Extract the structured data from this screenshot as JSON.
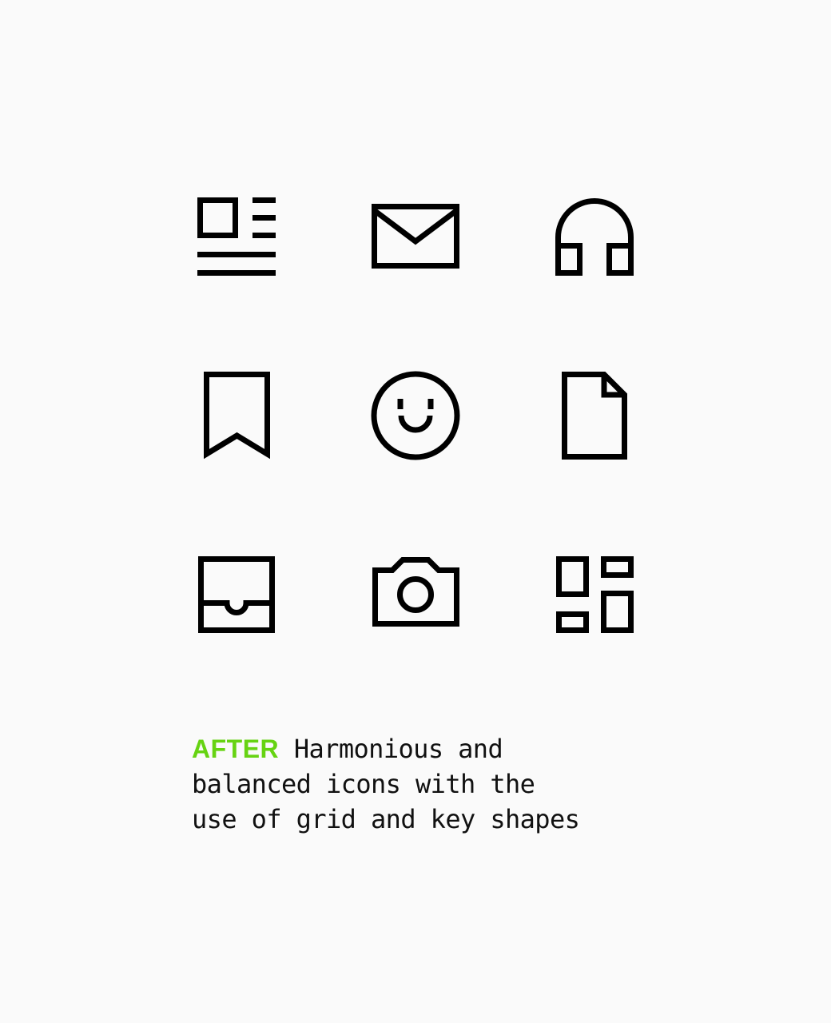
{
  "icons": [
    {
      "name": "news-icon",
      "label": "News"
    },
    {
      "name": "mail-icon",
      "label": "Mail"
    },
    {
      "name": "headphones-icon",
      "label": "Headphones"
    },
    {
      "name": "bookmark-icon",
      "label": "Bookmark"
    },
    {
      "name": "smiley-icon",
      "label": "Smiley"
    },
    {
      "name": "file-icon",
      "label": "File"
    },
    {
      "name": "inbox-icon",
      "label": "Inbox"
    },
    {
      "name": "camera-icon",
      "label": "Camera"
    },
    {
      "name": "dashboard-icon",
      "label": "Dashboard"
    }
  ],
  "caption": {
    "tag": "AFTER",
    "tag_color": "#66d312",
    "line1_rest": " Harmonious and",
    "line2": "balanced icons with the",
    "line3": "use of grid and key shapes"
  }
}
